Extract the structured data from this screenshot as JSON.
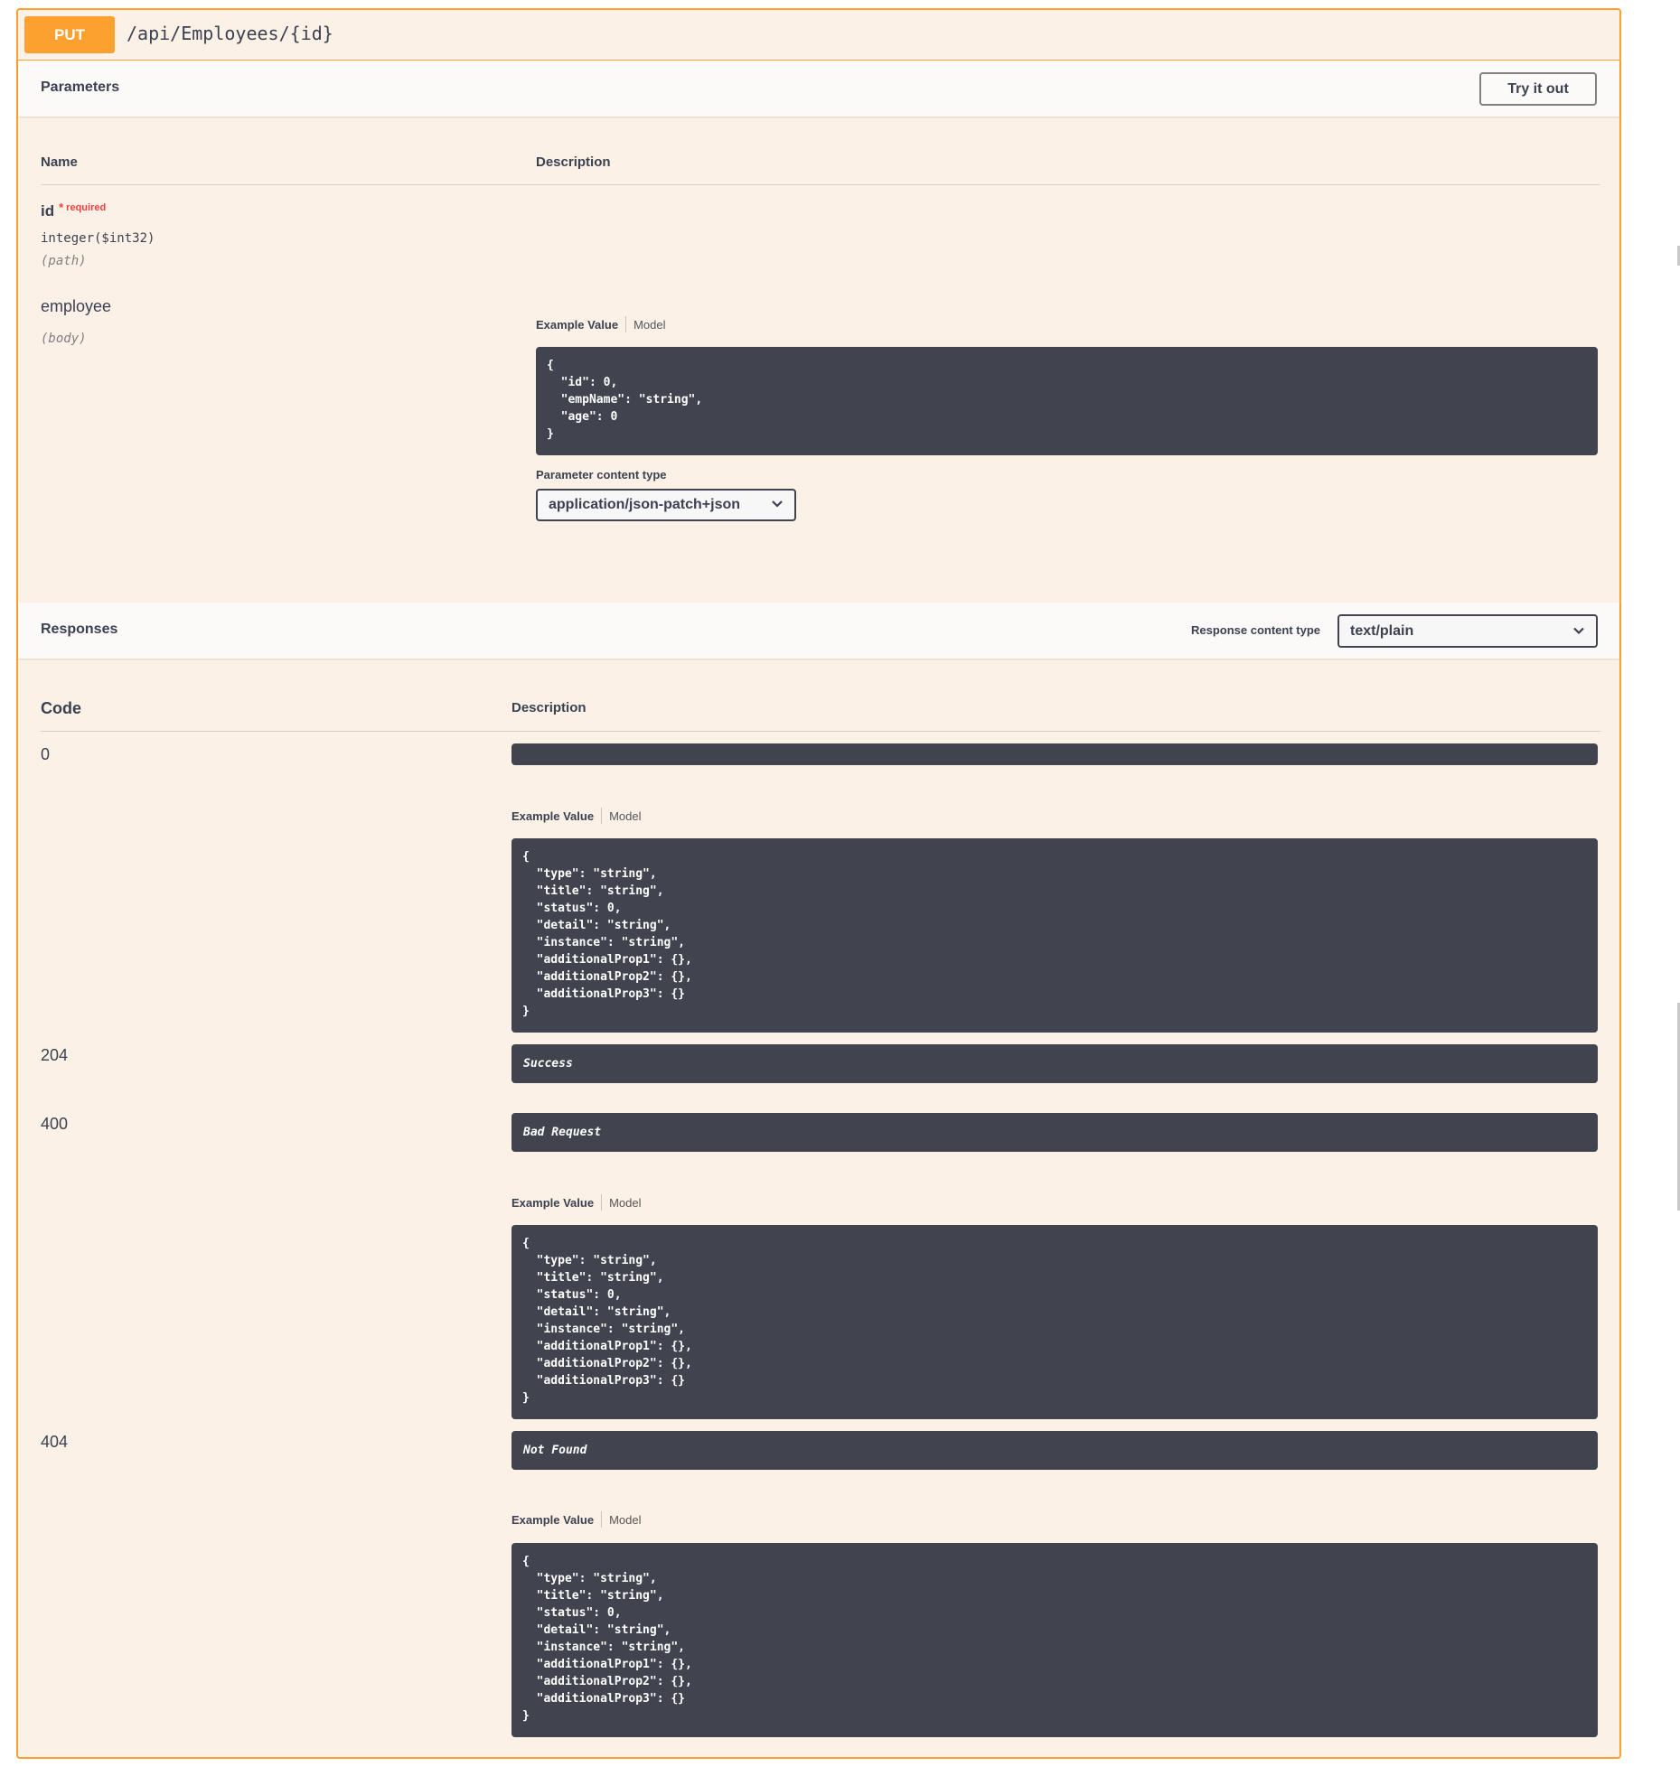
{
  "operation": {
    "method": "PUT",
    "path": "/api/Employees/{id}"
  },
  "parameters": {
    "heading": "Parameters",
    "try_label": "Try it out",
    "col_name": "Name",
    "col_description": "Description",
    "items": [
      {
        "name": "id",
        "required_star": "*",
        "required_label": "required",
        "type": "integer($int32)",
        "in": "(path)"
      },
      {
        "name": "employee",
        "in": "(body)",
        "example_tab": "Example Value",
        "model_tab": "Model",
        "example": "{\n  \"id\": 0,\n  \"empName\": \"string\",\n  \"age\": 0\n}",
        "content_type_label": "Parameter content type",
        "content_type_value": "application/json-patch+json"
      }
    ]
  },
  "responses": {
    "heading": "Responses",
    "content_type_label": "Response content type",
    "content_type_value": "text/plain",
    "col_code": "Code",
    "col_description": "Description",
    "items": [
      {
        "code": "0",
        "description": "",
        "example_tab": "Example Value",
        "model_tab": "Model",
        "example": "{\n  \"type\": \"string\",\n  \"title\": \"string\",\n  \"status\": 0,\n  \"detail\": \"string\",\n  \"instance\": \"string\",\n  \"additionalProp1\": {},\n  \"additionalProp2\": {},\n  \"additionalProp3\": {}\n}"
      },
      {
        "code": "204",
        "description": "Success"
      },
      {
        "code": "400",
        "description": "Bad Request",
        "example_tab": "Example Value",
        "model_tab": "Model",
        "example": "{\n  \"type\": \"string\",\n  \"title\": \"string\",\n  \"status\": 0,\n  \"detail\": \"string\",\n  \"instance\": \"string\",\n  \"additionalProp1\": {},\n  \"additionalProp2\": {},\n  \"additionalProp3\": {}\n}"
      },
      {
        "code": "404",
        "description": "Not Found",
        "example_tab": "Example Value",
        "model_tab": "Model",
        "example": "{\n  \"type\": \"string\",\n  \"title\": \"string\",\n  \"status\": 0,\n  \"detail\": \"string\",\n  \"instance\": \"string\",\n  \"additionalProp1\": {},\n  \"additionalProp2\": {},\n  \"additionalProp3\": {}\n}"
      }
    ]
  },
  "icons": {
    "select_chevron": "chevron-down-icon"
  },
  "colors": {
    "put_accent": "#fca130",
    "op_background": "#fcf1e6",
    "code_background": "#41444e",
    "required": "#f93e3e"
  }
}
